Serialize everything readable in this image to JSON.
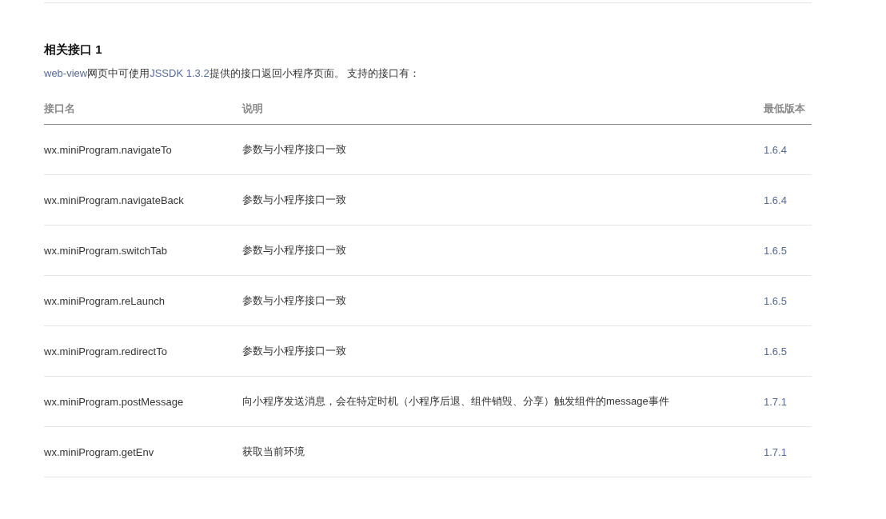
{
  "heading": "相关接口 1",
  "intro": [
    {
      "kind": "link",
      "text": "web-view"
    },
    {
      "kind": "text",
      "text": "网页中可使用"
    },
    {
      "kind": "link",
      "text": "JSSDK 1.3.2"
    },
    {
      "kind": "text",
      "text": "提供的接口返回小程序页面。 支持的接口有："
    }
  ],
  "table": {
    "columns": [
      "接口名",
      "说明",
      "最低版本"
    ],
    "rows": [
      {
        "name": "wx.miniProgram.navigateTo",
        "description": "参数与小程序接口一致",
        "version": "1.6.4"
      },
      {
        "name": "wx.miniProgram.navigateBack",
        "description": "参数与小程序接口一致",
        "version": "1.6.4"
      },
      {
        "name": "wx.miniProgram.switchTab",
        "description": "参数与小程序接口一致",
        "version": "1.6.5"
      },
      {
        "name": "wx.miniProgram.reLaunch",
        "description": "参数与小程序接口一致",
        "version": "1.6.5"
      },
      {
        "name": "wx.miniProgram.redirectTo",
        "description": "参数与小程序接口一致",
        "version": "1.6.5"
      },
      {
        "name": "wx.miniProgram.postMessage",
        "description": "向小程序发送消息，会在特定时机（小程序后退、组件销毁、分享）触发组件的message事件",
        "version": "1.7.1"
      },
      {
        "name": "wx.miniProgram.getEnv",
        "description": "获取当前环境",
        "version": "1.7.1"
      }
    ]
  }
}
